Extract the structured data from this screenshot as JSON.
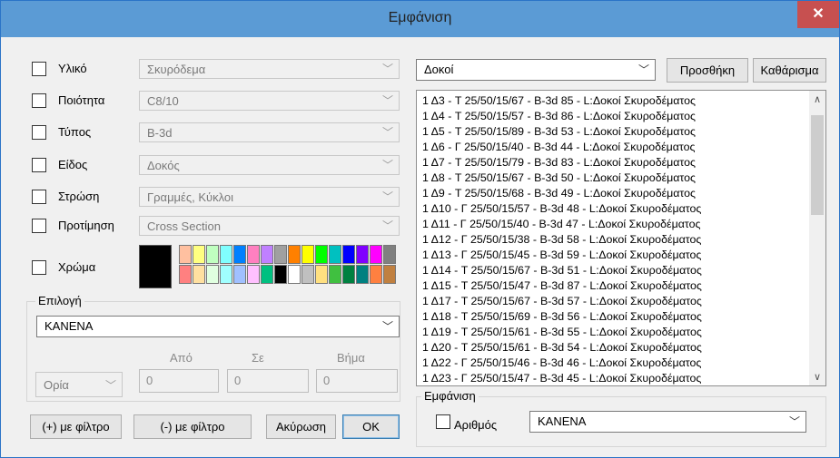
{
  "window": {
    "title": "Εμφάνιση",
    "close_glyph": "✕"
  },
  "filters": [
    {
      "label": "Υλικό",
      "value": "Σκυρόδεμα"
    },
    {
      "label": "Ποιότητα",
      "value": "C8/10"
    },
    {
      "label": "Τύπος",
      "value": "B-3d"
    },
    {
      "label": "Είδος",
      "value": "Δοκός"
    },
    {
      "label": "Στρώση",
      "value": "Γραμμές, Κύκλοι"
    },
    {
      "label": "Προτίμηση",
      "value": "Cross Section"
    }
  ],
  "color": {
    "label": "Χρώμα",
    "current": "#000000",
    "palette_row1": [
      "#ffc0a0",
      "#ffff80",
      "#c0ffc0",
      "#80ffff",
      "#0080ff",
      "#ff80c0",
      "#c080ff",
      "#a0a0a0",
      "#ff8000",
      "#ffff00",
      "#00ff00",
      "#00c0c0",
      "#0000ff",
      "#8000ff",
      "#ff00ff",
      "#808080"
    ],
    "palette_row2": [
      "#ff8080",
      "#ffe0a0",
      "#e0ffe0",
      "#a0ffff",
      "#a0c0ff",
      "#ffc0ff",
      "#00c080",
      "#000000",
      "#ffffff",
      "#c0c0c0",
      "#ffe080",
      "#40c040",
      "#008040",
      "#008080",
      "#ff8040",
      "#c08040"
    ]
  },
  "selection": {
    "group_label": "Επιλογή",
    "mode": "ΚΑΝΕΝΑ",
    "col_from": "Από",
    "col_to": "Σε",
    "col_step": "Βήμα",
    "range_type": "Ορία",
    "from_value": "0",
    "to_value": "0",
    "step_value": "0"
  },
  "buttons": {
    "with_filter": "(+) με φίλτρο",
    "without_filter": "(-) με φίλτρο",
    "cancel": "Ακύρωση",
    "ok": "OK",
    "add": "Προσθήκη",
    "clear": "Καθάρισμα"
  },
  "category": "Δοκοί",
  "list_items": [
    "1 Δ3 - T 25/50/15/67 - B-3d 85 - L:Δοκοί Σκυροδέματος",
    "1 Δ4 - T 25/50/15/57 - B-3d 86 - L:Δοκοί Σκυροδέματος",
    "1 Δ5 - T 25/50/15/89 - B-3d 53 - L:Δοκοί Σκυροδέματος",
    "1 Δ6 - Γ 25/50/15/40 - B-3d 44 - L:Δοκοί Σκυροδέματος",
    "1 Δ7 - T 25/50/15/79 - B-3d 83 - L:Δοκοί Σκυροδέματος",
    "1 Δ8 - T 25/50/15/67 - B-3d 50 - L:Δοκοί Σκυροδέματος",
    "1 Δ9 - T 25/50/15/68 - B-3d 49 - L:Δοκοί Σκυροδέματος",
    "1 Δ10 - Γ 25/50/15/57 - B-3d 48 - L:Δοκοί Σκυροδέματος",
    "1 Δ11 - Γ 25/50/15/40 - B-3d 47 - L:Δοκοί Σκυροδέματος",
    "1 Δ12 - Γ 25/50/15/38 - B-3d 58 - L:Δοκοί Σκυροδέματος",
    "1 Δ13 - Γ 25/50/15/45 - B-3d 59 - L:Δοκοί Σκυροδέματος",
    "1 Δ14 - T 25/50/15/67 - B-3d 51 - L:Δοκοί Σκυροδέματος",
    "1 Δ15 - T 25/50/15/47 - B-3d 87 - L:Δοκοί Σκυροδέματος",
    "1 Δ17 - T 25/50/15/67 - B-3d 57 - L:Δοκοί Σκυροδέματος",
    "1 Δ18 - T 25/50/15/69 - B-3d 56 - L:Δοκοί Σκυροδέματος",
    "1 Δ19 - T 25/50/15/61 - B-3d 55 - L:Δοκοί Σκυροδέματος",
    "1 Δ20 - T 25/50/15/61 - B-3d 54 - L:Δοκοί Σκυροδέματος",
    "1 Δ22 - Γ 25/50/15/46 - B-3d 46 - L:Δοκοί Σκυροδέματος",
    "1 Δ23 - Γ 25/50/15/47 - B-3d 45 - L:Δοκοί Σκυροδέματος"
  ],
  "display": {
    "group_label": "Εμφάνιση",
    "number_label": "Αριθμός",
    "number_mode": "ΚΑΝΕΝΑ"
  }
}
